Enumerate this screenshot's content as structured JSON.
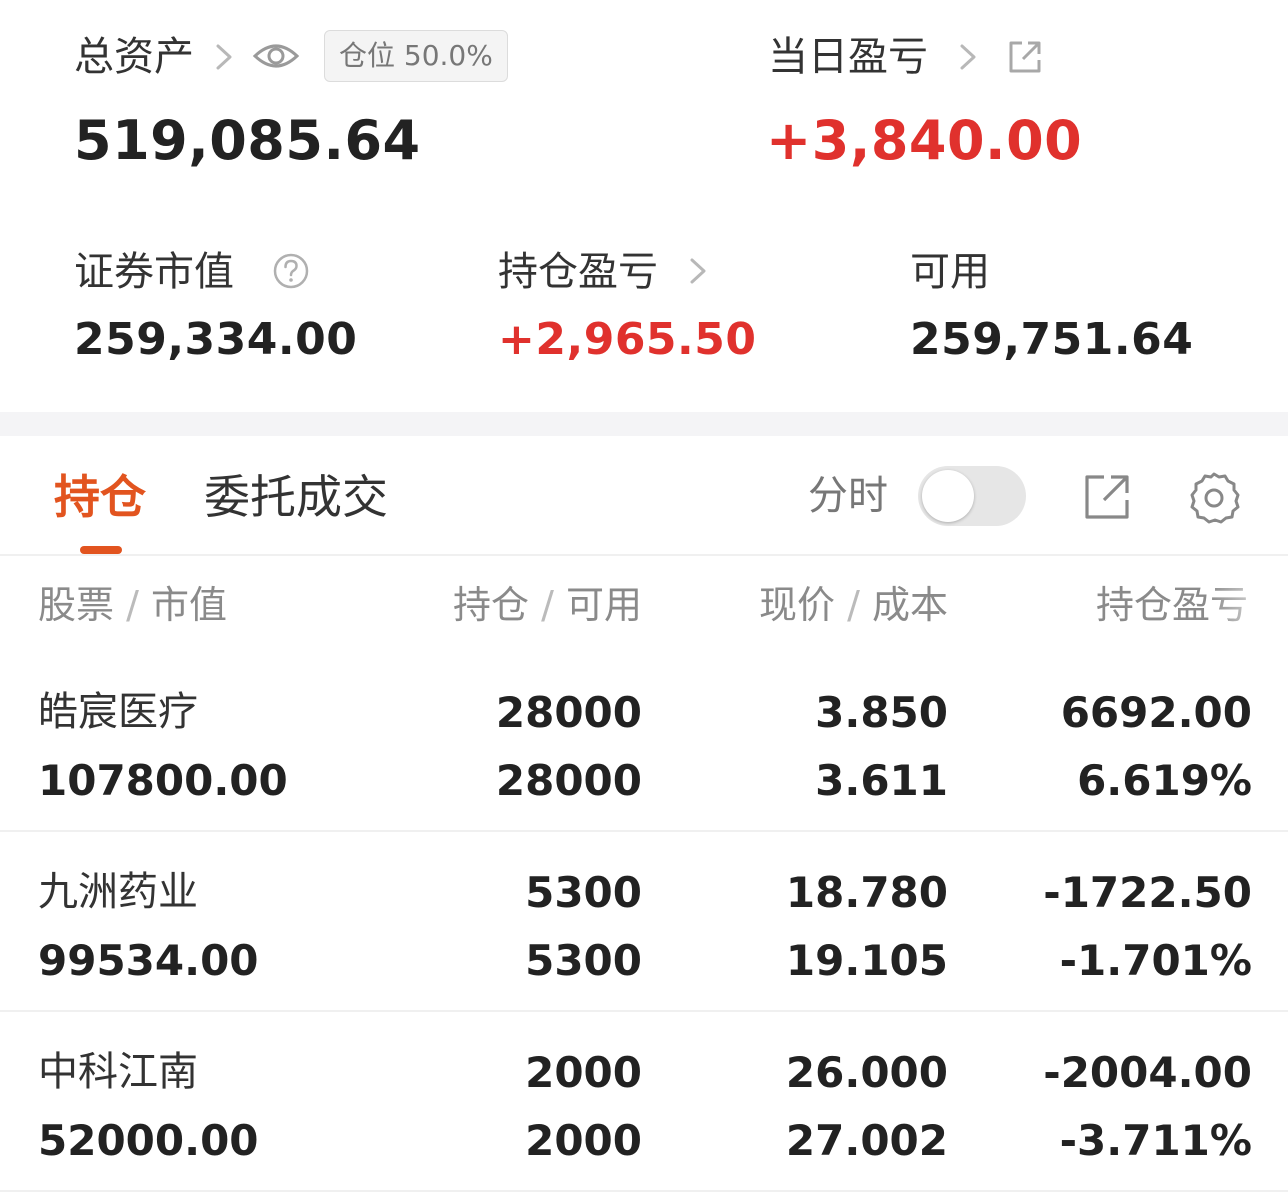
{
  "summary": {
    "total_assets_label": "总资产",
    "position_badge": "仓位 50.0%",
    "total_assets_value": "519,085.64",
    "daily_pl_label": "当日盈亏",
    "daily_pl_value": "+3,840.00",
    "market_value_label": "证券市值",
    "market_value_value": "259,334.00",
    "holding_pl_label": "持仓盈亏",
    "holding_pl_value": "+2,965.50",
    "available_label": "可用",
    "available_value": "259,751.64"
  },
  "tabs": {
    "holdings": "持仓",
    "orders": "委托成交",
    "intraday_label": "分时"
  },
  "table": {
    "headers": {
      "stock": "股票",
      "stock_sub": "市值",
      "position": "持仓",
      "position_sub": "可用",
      "price": "现价",
      "price_sub": "成本",
      "pl": "持仓盈亏"
    },
    "rows": [
      {
        "name": "皓宸医疗",
        "market_value": "107800.00",
        "position": "28000",
        "available": "28000",
        "price": "3.850",
        "cost": "3.611",
        "pl": "6692.00",
        "pl_pct": "6.619%"
      },
      {
        "name": "九洲药业",
        "market_value": "99534.00",
        "position": "5300",
        "available": "5300",
        "price": "18.780",
        "cost": "19.105",
        "pl": "-1722.50",
        "pl_pct": "-1.701%"
      },
      {
        "name": "中科江南",
        "market_value": "52000.00",
        "position": "2000",
        "available": "2000",
        "price": "26.000",
        "cost": "27.002",
        "pl": "-2004.00",
        "pl_pct": "-3.711%"
      }
    ]
  },
  "colors": {
    "accent": "#e2541f",
    "gain": "#e0312d",
    "loss": "#46a13a"
  },
  "icons": [
    "chevron-right-icon",
    "eye-icon",
    "external-link-icon",
    "question-circle-icon",
    "gear-icon"
  ]
}
